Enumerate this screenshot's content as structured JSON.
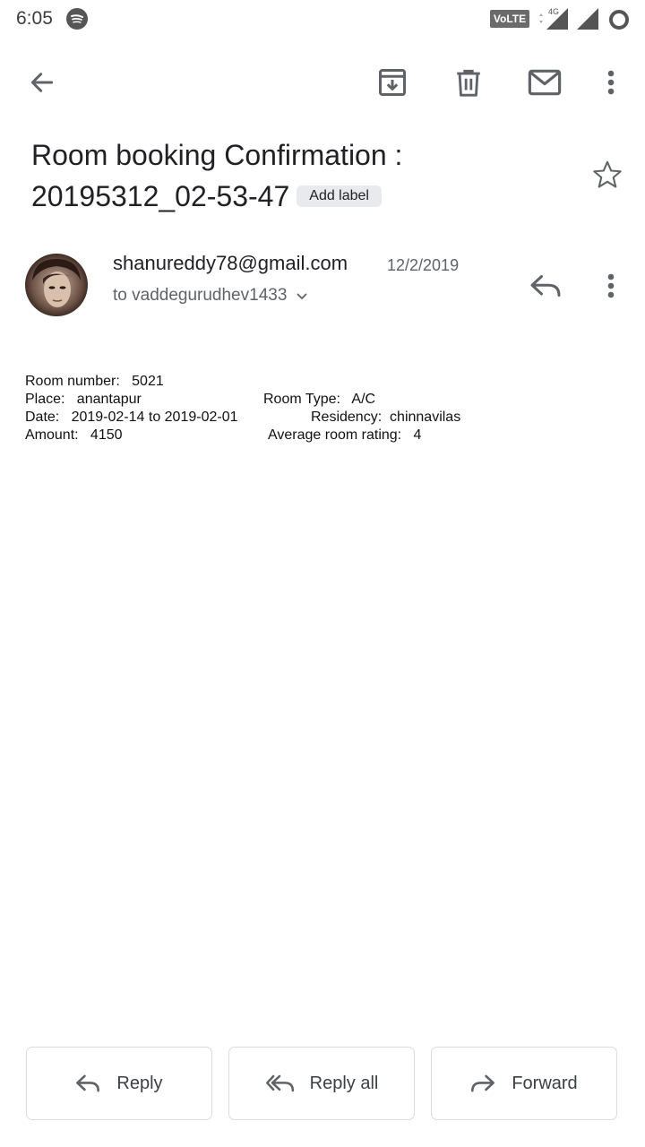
{
  "status_bar": {
    "time": "6:05",
    "volte": "VoLTE",
    "network": "4G",
    "icons": [
      "spotify-icon",
      "signal-icon",
      "signal-icon",
      "battery-ring-icon"
    ]
  },
  "toolbar": {
    "icons": [
      "back-arrow-icon",
      "archive-icon",
      "delete-icon",
      "mail-unread-icon",
      "more-vert-icon"
    ]
  },
  "email": {
    "subject_line1": "Room booking Confirmation :",
    "subject_line2": "20195312_02-53-47",
    "label_chip": "Add label",
    "sender": "shanureddy78@gmail.com",
    "date": "12/2/2019",
    "recipients": "to vaddegurudhev1433",
    "body": {
      "room_number": "Room number:   5021",
      "place": "Place:   anantapur",
      "room_type": "Room Type:   A/C",
      "date": "Date:   2019-02-14 to 2019-02-01",
      "residency": "Residency:  chinnavilas",
      "amount": "Amount:   4150",
      "rating": "Average room rating:   4"
    }
  },
  "actions": {
    "reply": "Reply",
    "reply_all": "Reply all",
    "forward": "Forward"
  },
  "colors": {
    "icon": "#5f6368",
    "button_border": "#dadce0",
    "chip_bg": "#e8eaed"
  }
}
